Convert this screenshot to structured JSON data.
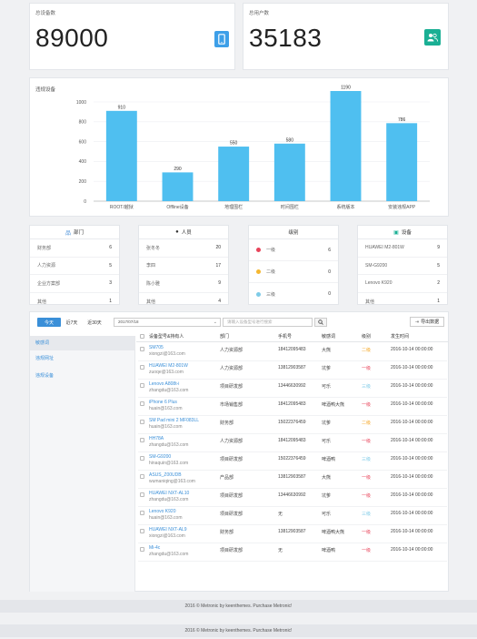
{
  "stats": [
    {
      "label": "总设备数",
      "value": "89000",
      "icon": "mobile-icon",
      "color": "#3d9fe8"
    },
    {
      "label": "总用户数",
      "value": "35183",
      "icon": "users-icon",
      "color": "#1aaf94"
    }
  ],
  "chart_title": "违规设备",
  "chart_data": {
    "type": "bar",
    "categories": [
      "ROOT/越狱",
      "Offline设备",
      "地理围栏",
      "时间围栏",
      "系统版本",
      "安装违规APP"
    ],
    "values": [
      910,
      290,
      550,
      580,
      1190,
      786
    ],
    "ylim": [
      0,
      1000
    ],
    "yticks": [
      0,
      200,
      400,
      600,
      800,
      1000
    ],
    "color": "#4fbff0",
    "grid": true
  },
  "panels": {
    "dept": {
      "title": "部门",
      "icon": "org-icon",
      "items": [
        {
          "label": "财务部",
          "value": "6"
        },
        {
          "label": "人力资源",
          "value": "5"
        },
        {
          "label": "企业方案部",
          "value": "3"
        },
        {
          "label": "其他",
          "value": "1"
        }
      ]
    },
    "people": {
      "title": "人员",
      "icon": "person-icon",
      "items": [
        {
          "label": "张冬冬",
          "value": "20"
        },
        {
          "label": "李四",
          "value": "17"
        },
        {
          "label": "陈小雅",
          "value": "9"
        },
        {
          "label": "其他",
          "value": "4"
        }
      ]
    },
    "level": {
      "title": "级别",
      "items": [
        {
          "label": "一级",
          "value": "6",
          "color": "#e8445a"
        },
        {
          "label": "二级",
          "value": "0",
          "color": "#f5b731"
        },
        {
          "label": "三级",
          "value": "0",
          "color": "#7ecbe7"
        }
      ]
    },
    "device": {
      "title": "设备",
      "icon": "device-icon",
      "items": [
        {
          "label": "HUAWEI M2-801W",
          "value": "9"
        },
        {
          "label": "SM-G9200",
          "value": "5"
        },
        {
          "label": "Lenovo K920",
          "value": "2"
        },
        {
          "label": "其他",
          "value": "1"
        }
      ]
    }
  },
  "toolbar": {
    "tabs": [
      "今天",
      "近7天",
      "近30天"
    ],
    "date_value": "2017/07/18",
    "search_placeholder": "请输入设备型号进行搜索",
    "export_label": "导出数据"
  },
  "side_nav": [
    "敏感词",
    "违规网址",
    "违规设备"
  ],
  "table": {
    "headers": [
      "设备型号&持有人",
      "部门",
      "手机号",
      "敏感词",
      "级别",
      "发生时间"
    ],
    "rows": [
      {
        "device": "SM705",
        "email": "xiongzi@163.com",
        "dept": "人力资源部",
        "phone": "18412095483",
        "word": "大熊",
        "level": "二级",
        "time": "2016-10-14 00:00:00"
      },
      {
        "device": "HUAWEI M2-801W",
        "email": "zuoqe@163.com",
        "dept": "人力资源部",
        "phone": "13812903587",
        "word": "坑爹",
        "level": "一级",
        "time": "2016-10-14 00:00:00"
      },
      {
        "device": "Lenovo A808t-i",
        "email": "zhangdu@163.com",
        "dept": "项目研发部",
        "phone": "13446630992",
        "word": "可乐",
        "level": "三级",
        "time": "2016-10-14 00:00:00"
      },
      {
        "device": "iPhone 6 Plus",
        "email": "huain@163.com",
        "dept": "市场销售部",
        "phone": "18412095483",
        "word": "啤酒鸭大熊",
        "level": "一级",
        "time": "2016-10-14 00:00:00"
      },
      {
        "device": "SM Pad mini 2 MF083LL",
        "email": "huain@163.com",
        "dept": "财务部",
        "phone": "15022376459",
        "word": "坑爹",
        "level": "二级",
        "time": "2016-10-14 00:00:00"
      },
      {
        "device": "HH78A",
        "email": "zhangdu@163.com",
        "dept": "人力资源部",
        "phone": "18412095483",
        "word": "可乐",
        "level": "一级",
        "time": "2016-10-14 00:00:00"
      },
      {
        "device": "SM-G9200",
        "email": "hinaquin@163.com",
        "dept": "项目研发部",
        "phone": "15022376459",
        "word": "啤酒鸭",
        "level": "三级",
        "time": "2016-10-14 00:00:00"
      },
      {
        "device": "ASUS_Z00UDB",
        "email": "wumaniqing@163.com",
        "dept": "产品部",
        "phone": "13812903587",
        "word": "大熊",
        "level": "一级",
        "time": "2016-10-14 00:00:00"
      },
      {
        "device": "HUAWEI NXT-AL10",
        "email": "zhangdu@163.com",
        "dept": "项目研发部",
        "phone": "13446630992",
        "word": "坑爹",
        "level": "一级",
        "time": "2016-10-14 00:00:00"
      },
      {
        "device": "Lenovo K920",
        "email": "huain@163.com",
        "dept": "项目研发部",
        "phone": "无",
        "word": "可乐",
        "level": "三级",
        "time": "2016-10-14 00:00:00"
      },
      {
        "device": "HUAWEI NXT-AL9",
        "email": "xiongzi@163.com",
        "dept": "财务部",
        "phone": "13812903587",
        "word": "啤酒鸭大熊",
        "level": "一级",
        "time": "2016-10-14 00:00:00"
      },
      {
        "device": "Mi-4c",
        "email": "zhangdu@163.com",
        "dept": "项目研发部",
        "phone": "无",
        "word": "啤酒鸭",
        "level": "一级",
        "time": "2016-10-14 00:00:00"
      }
    ]
  },
  "level_colors": {
    "一级": "#e8445a",
    "二级": "#f5a623",
    "三级": "#7ecbe7"
  },
  "footer": "2016 © Metronic by keenthemes. Purchase Metronic!"
}
